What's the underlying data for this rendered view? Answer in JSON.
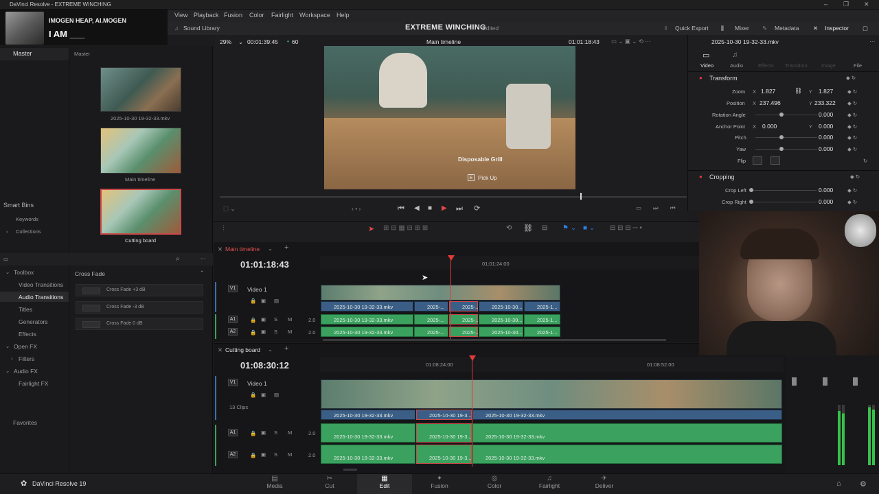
{
  "window": {
    "title": "DaVinci Resolve - EXTREME WINCHING"
  },
  "overlay": {
    "line1": "IMOGEN HEAP, AI.MOGEN",
    "line2": "I AM ___"
  },
  "menu": [
    "View",
    "Playback",
    "Fusion",
    "Color",
    "Fairlight",
    "Workspace",
    "Help"
  ],
  "header": {
    "sound_library": "Sound Library",
    "project": "EXTREME WINCHING",
    "status": "Edited",
    "quick_export": "Quick Export",
    "mixer": "Mixer",
    "metadata": "Metadata",
    "inspector": "Inspector"
  },
  "media": {
    "master_left": "Master",
    "master_right": "Master",
    "clips": [
      {
        "name": "2025-10-30 19-32-33.mkv"
      },
      {
        "name": "Main timeline"
      },
      {
        "name": "Cutting board"
      }
    ],
    "smart_bins": "Smart Bins",
    "keywords": "Keywords",
    "collections": "Collections"
  },
  "viewer": {
    "zoom": "29%",
    "timecode_in": "00:01:39:45",
    "fps": "60",
    "timeline_name": "Main timeline",
    "timecode_out": "01:01:18:43",
    "prompt_item": "Disposable Grill",
    "prompt_key": "E",
    "prompt_action": "Pick Up"
  },
  "toolbox": {
    "items": [
      "Toolbox",
      "Video Transitions",
      "Audio Transitions",
      "Titles",
      "Generators",
      "Effects",
      "Open FX",
      "Filters",
      "Audio FX",
      "Fairlight FX",
      "Favorites"
    ],
    "section": "Cross Fade",
    "fx": [
      "Cross Fade +3 dB",
      "Cross Fade -3 dB",
      "Cross Fade 0 dB"
    ]
  },
  "timeline1": {
    "tab": "Main timeline",
    "timecode": "01:01:18:43",
    "ruler": "01:01:24:00",
    "v1": "V1",
    "v1name": "Video 1",
    "a1": "A1",
    "a2": "A2",
    "level": "2.0",
    "clips": [
      "2025-10-30 19-32-33.mkv",
      "2025-...",
      "2025-...",
      "2025-10-30...",
      "2025-1..."
    ]
  },
  "timeline2": {
    "tab": "Cutting board",
    "timecode": "01:08:30:12",
    "ruler1": "01:08:24:00",
    "ruler2": "01:08:52:00",
    "v1": "V1",
    "v1name": "Video 1",
    "clips_count": "13 Clips",
    "a1": "A1",
    "a2": "A2",
    "level": "2.0",
    "clips": [
      "2025-10-30 19-32-33.mkv",
      "2025-10-30 19-3...",
      "2025-10-30 19-32-33.mkv"
    ]
  },
  "inspector": {
    "clip": "2025-10-30 19-32-33.mkv",
    "tabs": [
      "Video",
      "Audio",
      "Effects",
      "Transition",
      "Image",
      "File"
    ],
    "transform": "Transform",
    "zoom_label": "Zoom",
    "zoom_x": "1.827",
    "zoom_y": "1.827",
    "position_label": "Position",
    "pos_x": "237.496",
    "pos_y": "233.322",
    "rotation_label": "Rotation Angle",
    "rotation": "0.000",
    "anchor_label": "Anchor Point",
    "anchor_x": "0.000",
    "anchor_y": "0.000",
    "pitch_label": "Pitch",
    "pitch": "0.000",
    "yaw_label": "Yaw",
    "yaw": "0.000",
    "flip_label": "Flip",
    "cropping": "Cropping",
    "crop_left_label": "Crop Left",
    "crop_left": "0.000",
    "crop_right_label": "Crop Right",
    "crop_right": "0.000"
  },
  "bottom": {
    "app": "DaVinci Resolve 19",
    "pages": [
      "Media",
      "Cut",
      "Edit",
      "Fusion",
      "Color",
      "Fairlight",
      "Deliver"
    ]
  }
}
